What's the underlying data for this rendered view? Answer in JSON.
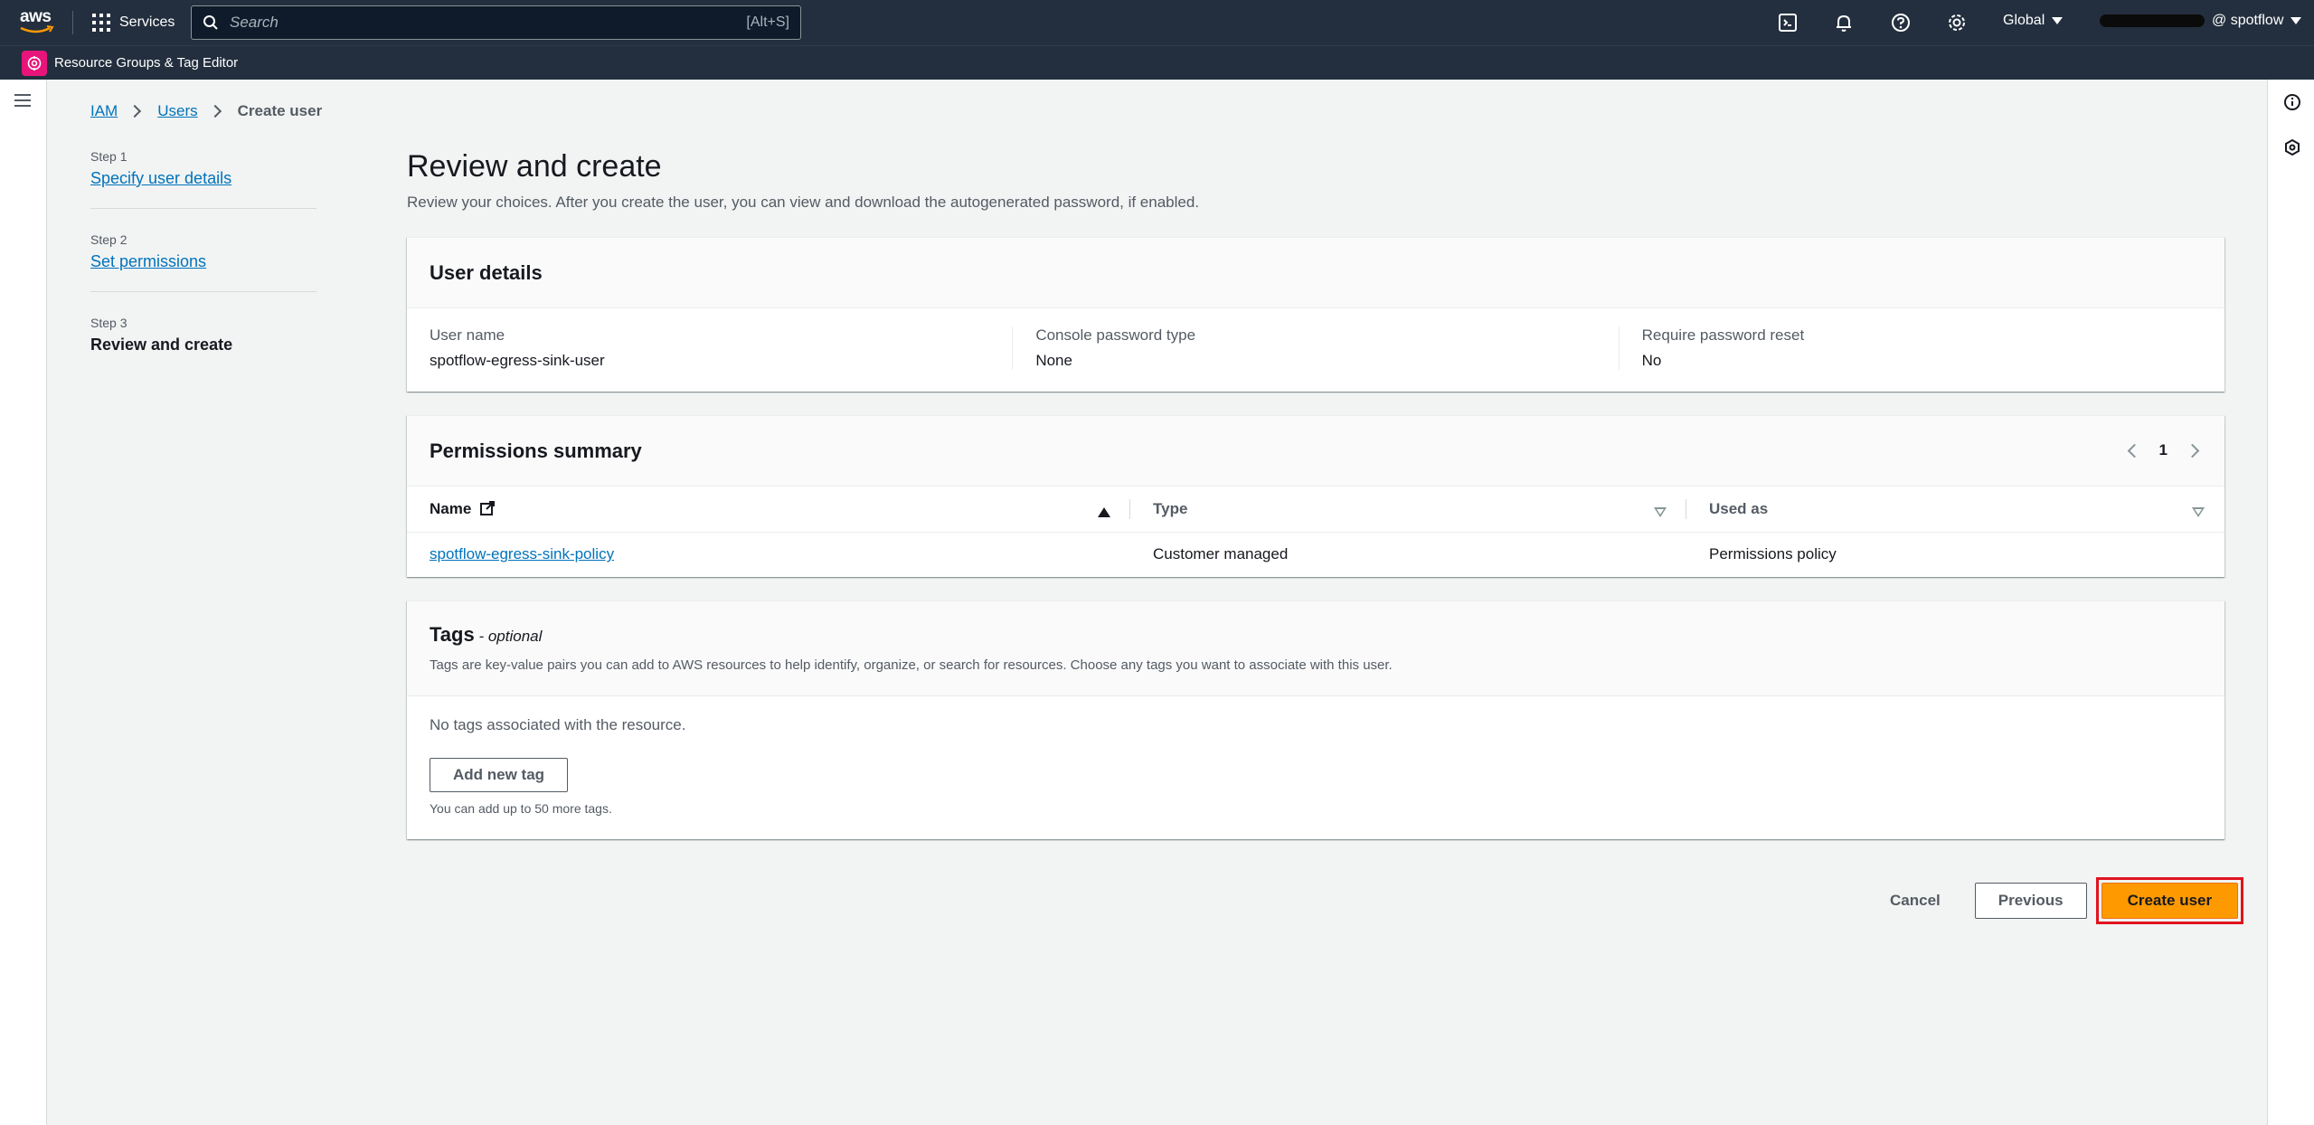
{
  "topnav": {
    "logo_text": "aws",
    "services_label": "Services",
    "search_placeholder": "Search",
    "search_hint": "[Alt+S]",
    "region": "Global",
    "account": "@ spotflow"
  },
  "servicebar": {
    "label": "Resource Groups & Tag Editor"
  },
  "breadcrumb": {
    "items": [
      "IAM",
      "Users"
    ],
    "current": "Create user"
  },
  "steps": [
    {
      "num": "Step 1",
      "label": "Specify user details"
    },
    {
      "num": "Step 2",
      "label": "Set permissions"
    },
    {
      "num": "Step 3",
      "label": "Review and create"
    }
  ],
  "main": {
    "title": "Review and create",
    "description": "Review your choices. After you create the user, you can view and download the autogenerated password, if enabled."
  },
  "user_details": {
    "title": "User details",
    "fields": [
      {
        "label": "User name",
        "value": "spotflow-egress-sink-user"
      },
      {
        "label": "Console password type",
        "value": "None"
      },
      {
        "label": "Require password reset",
        "value": "No"
      }
    ]
  },
  "permissions": {
    "title": "Permissions summary",
    "page": "1",
    "columns": [
      "Name",
      "Type",
      "Used as"
    ],
    "rows": [
      {
        "name": "spotflow-egress-sink-policy",
        "type": "Customer managed",
        "used_as": "Permissions policy"
      }
    ]
  },
  "tags": {
    "title": "Tags",
    "optional": " - optional",
    "subtitle": "Tags are key-value pairs you can add to AWS resources to help identify, organize, or search for resources. Choose any tags you want to associate with this user.",
    "empty": "No tags associated with the resource.",
    "add_button": "Add new tag",
    "limit_note": "You can add up to 50 more tags."
  },
  "actions": {
    "cancel": "Cancel",
    "previous": "Previous",
    "create": "Create user"
  },
  "colors": {
    "nav_bg": "#232f3e",
    "primary": "#ff9900",
    "link": "#0073bb",
    "highlight": "#e0141e"
  }
}
